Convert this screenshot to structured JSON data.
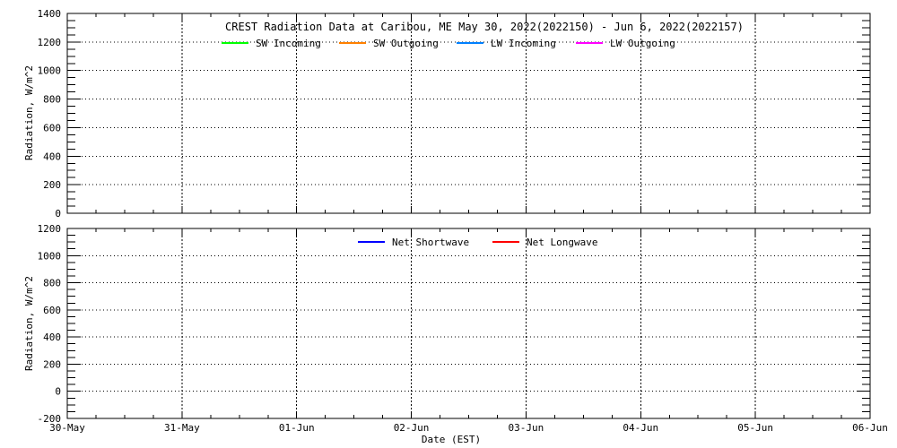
{
  "page": {
    "background": "#ffffff",
    "text_color": "#000000"
  },
  "chart_data": [
    {
      "id": "radiation-components-panel",
      "type": "line",
      "title": "CREST Radiation Data at Caribou, ME   May 30, 2022(2022150) - Jun 6, 2022(2022157)",
      "ylabel": "Radiation, W/m^2",
      "ylim": [
        0,
        1400
      ],
      "ytick_major": 200,
      "ytick_minor": 50,
      "ytick_labels": [
        "0",
        "200",
        "400",
        "600",
        "800",
        "1000",
        "1200",
        "1400"
      ],
      "x_tick_labels": [
        "30-May",
        "31-May",
        "01-Jun",
        "02-Jun",
        "03-Jun",
        "04-Jun",
        "05-Jun",
        "06-Jun"
      ],
      "x_minor_divisions": 4,
      "grid": true,
      "legend_position": "top-inside",
      "series": [
        {
          "name": "SW Incoming",
          "color": "#00ff00",
          "x": [],
          "values": []
        },
        {
          "name": "SW Outgoing",
          "color": "#ff8000",
          "x": [],
          "values": []
        },
        {
          "name": "LW Incoming",
          "color": "#0080ff",
          "x": [],
          "values": []
        },
        {
          "name": "LW Outgoing",
          "color": "#ff00ff",
          "x": [],
          "values": []
        }
      ]
    },
    {
      "id": "net-radiation-panel",
      "type": "line",
      "title": "",
      "xlabel": "Date (EST)",
      "ylabel": "Radiation, W/m^2",
      "ylim": [
        -200,
        1200
      ],
      "ytick_major": 200,
      "ytick_minor": 50,
      "ytick_labels": [
        "-200",
        "0",
        "200",
        "400",
        "600",
        "800",
        "1000",
        "1200"
      ],
      "x_tick_labels": [
        "30-May",
        "31-May",
        "01-Jun",
        "02-Jun",
        "03-Jun",
        "04-Jun",
        "05-Jun",
        "06-Jun"
      ],
      "x_minor_divisions": 4,
      "grid": true,
      "legend_position": "top-inside",
      "series": [
        {
          "name": "Net Shortwave",
          "color": "#0000ff",
          "x": [],
          "values": []
        },
        {
          "name": "Net Longwave",
          "color": "#ff0000",
          "x": [],
          "values": []
        }
      ]
    }
  ]
}
